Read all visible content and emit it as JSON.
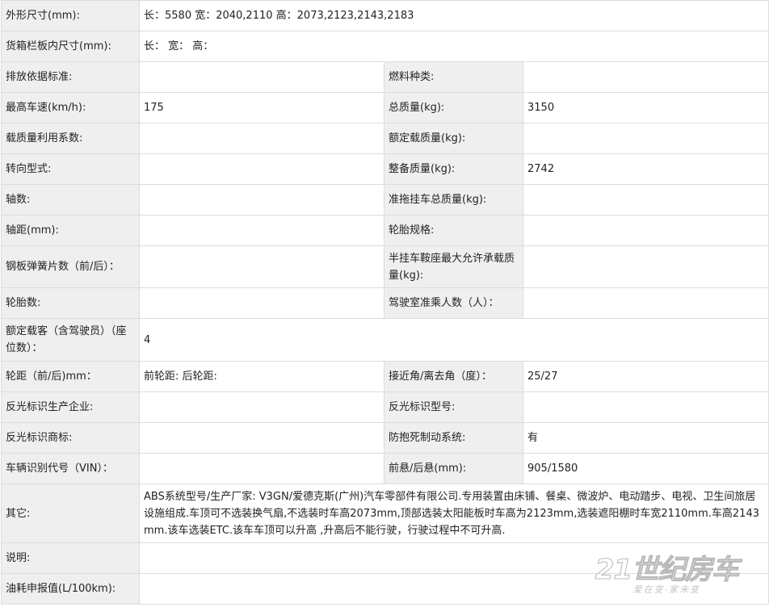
{
  "rows": [
    {
      "l1": "外形尺寸(mm):",
      "v1": "长：5580 宽：2040,2110 高：2073,2123,2143,2183"
    },
    {
      "l1": "货箱栏板内尺寸(mm):",
      "v1": "长：  宽：  高："
    },
    {
      "l1": "排放依据标准:",
      "v1": "",
      "l2": "燃料种类:",
      "v2": ""
    },
    {
      "l1": "最高车速(km/h):",
      "v1": "175",
      "l2": "总质量(kg):",
      "v2": "3150"
    },
    {
      "l1": "载质量利用系数:",
      "v1": "",
      "l2": "额定载质量(kg):",
      "v2": ""
    },
    {
      "l1": "转向型式:",
      "v1": "",
      "l2": "整备质量(kg):",
      "v2": "2742"
    },
    {
      "l1": "轴数:",
      "v1": "",
      "l2": "准拖挂车总质量(kg):",
      "v2": ""
    },
    {
      "l1": "轴距(mm):",
      "v1": "",
      "l2": "轮胎规格:",
      "v2": ""
    },
    {
      "l1": "钢板弹簧片数（前/后）：",
      "v1": "",
      "l2": "半挂车鞍座最大允许承载质量(kg):",
      "v2": ""
    },
    {
      "l1": "轮胎数:",
      "v1": "",
      "l2": "驾驶室准乘人数（人）：",
      "v2": ""
    },
    {
      "l1": "额定载客（含驾驶员）（座位数）：",
      "v1": "4"
    },
    {
      "l1": "轮距（前/后)mm：",
      "v1": "前轮距: 后轮距:",
      "l2": "接近角/离去角（度）：",
      "v2": "25/27"
    },
    {
      "l1": "反光标识生产企业:",
      "v1": "",
      "l2": "反光标识型号:",
      "v2": ""
    },
    {
      "l1": "反光标识商标:",
      "v1": "",
      "l2": "防抱死制动系统:",
      "v2": "有"
    },
    {
      "l1": "车辆识别代号（VIN）：",
      "v1": "",
      "l2": "前悬/后悬(mm):",
      "v2": "905/1580"
    },
    {
      "l1": "其它:",
      "v1": "ABS系统型号/生产厂家: V3GN/爱德克斯(广州)汽车零部件有限公司.专用装置由床铺、餐桌、微波炉、电动踏步、电视、卫生间旅居设施组成.车顶可不选装换气扇,不选装时车高2073mm,顶部选装太阳能板时车高为2123mm,选装遮阳棚时车宽2110mm.车高2143mm.该车选装ETC.该车车顶可以升高 ,升高后不能行驶，行驶过程中不可升高."
    },
    {
      "l1": "说明:",
      "v1": ""
    },
    {
      "l1": "油耗申报值(L/100km):",
      "v1": ""
    }
  ],
  "watermark": {
    "main": "21世纪房车",
    "sub": "爱在变·家未变"
  }
}
